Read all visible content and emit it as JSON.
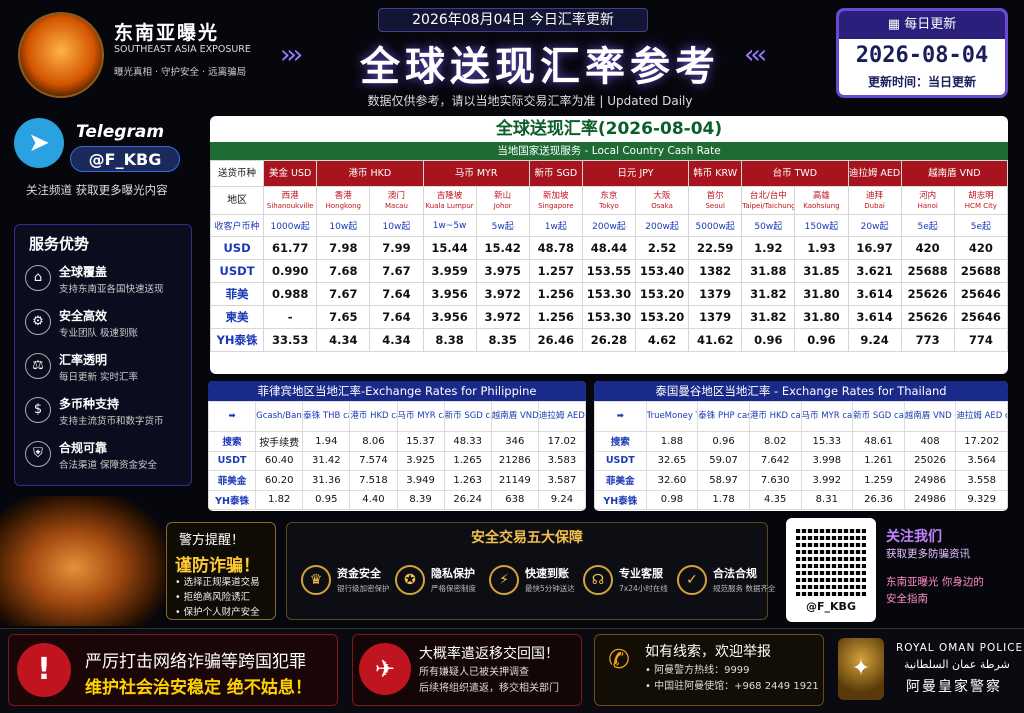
{
  "header": {
    "brand_cn": "东南亚曝光",
    "brand_en": "SOUTHEAST ASIA EXPOSURE",
    "brand_sub": "曝光真相 · 守护安全 · 远离骗局",
    "date_line": "2026年08月04日 今日汇率更新",
    "main_title": "全球送现汇率参考",
    "subtitle": "数据仅供参考，请以当地实际交易汇率为准 | Updated Daily",
    "daily_label": "每日更新",
    "daily_date": "2026-08-04",
    "daily_update": "更新时间：当日更新"
  },
  "telegram": {
    "title": "Telegram",
    "handle": "@F_KBG",
    "desc": "关注频道  获取更多曝光内容"
  },
  "advantages": {
    "title": "服务优势",
    "items": [
      {
        "icon": "building-icon",
        "title": "全球覆盖",
        "desc": "支持东南亚各国快速送现"
      },
      {
        "icon": "gear-icon",
        "title": "安全高效",
        "desc": "专业团队 极速到账"
      },
      {
        "icon": "balance-icon",
        "title": "汇率透明",
        "desc": "每日更新  实时汇率"
      },
      {
        "icon": "currency-icon",
        "title": "多币种支持",
        "desc": "支持主流货币和数字货币"
      },
      {
        "icon": "shield-icon",
        "title": "合规可靠",
        "desc": "合法渠道 保障资金安全"
      }
    ]
  },
  "main_table": {
    "title": "全球送现汇率(2026-08-04)",
    "subtitle": "当地国家送现服务 - Local Country Cash Rate",
    "row_labels": {
      "currency": "送货币种",
      "region": "地区",
      "receive": "收客户币种"
    },
    "currencies": [
      {
        "label": "美金 USD",
        "span": 1
      },
      {
        "label": "港币 HKD",
        "span": 2
      },
      {
        "label": "马币 MYR",
        "span": 2
      },
      {
        "label": "新币 SGD",
        "span": 1
      },
      {
        "label": "日元 JPY",
        "span": 2
      },
      {
        "label": "韩币 KRW",
        "span": 1
      },
      {
        "label": "台币 TWD",
        "span": 2
      },
      {
        "label": "迪拉姆 AED",
        "span": 1
      },
      {
        "label": "越南盾 VND",
        "span": 2
      }
    ],
    "regions": [
      {
        "cn": "西港",
        "en": "Sihanoukville"
      },
      {
        "cn": "香港",
        "en": "Hongkong"
      },
      {
        "cn": "澳门",
        "en": "Macau"
      },
      {
        "cn": "吉隆坡",
        "en": "Kuala Lumpur"
      },
      {
        "cn": "新山",
        "en": "Johor"
      },
      {
        "cn": "新加坡",
        "en": "Singapore"
      },
      {
        "cn": "东京",
        "en": "Tokyo"
      },
      {
        "cn": "大阪",
        "en": "Osaka"
      },
      {
        "cn": "首尔",
        "en": "Seoul"
      },
      {
        "cn": "台北/台中",
        "en": "Taipei/Taichung"
      },
      {
        "cn": "高雄",
        "en": "Kaohsiung"
      },
      {
        "cn": "迪拜",
        "en": "Dubai"
      },
      {
        "cn": "河内",
        "en": "Hanoi"
      },
      {
        "cn": "胡志明",
        "en": "HCM City"
      }
    ],
    "receive": [
      "1000w起",
      "10w起",
      "10w起",
      "1w~5w",
      "5w起",
      "1w起",
      "200w起",
      "200w起",
      "5000w起",
      "50w起",
      "150w起",
      "20w起",
      "5e起",
      "5e起"
    ],
    "rows": [
      {
        "label": "USD",
        "values": [
          "61.77",
          "7.98",
          "7.99",
          "15.44",
          "15.42",
          "48.78",
          "48.44",
          "2.52",
          "22.59",
          "1.92",
          "1.93",
          "16.97",
          "420",
          "420"
        ]
      },
      {
        "label": "USDT",
        "values": [
          "0.990",
          "7.68",
          "7.67",
          "3.959",
          "3.975",
          "1.257",
          "153.55",
          "153.40",
          "1382",
          "31.88",
          "31.85",
          "3.621",
          "25688",
          "25688"
        ]
      },
      {
        "label": "菲美",
        "values": [
          "0.988",
          "7.67",
          "7.64",
          "3.956",
          "3.972",
          "1.256",
          "153.30",
          "153.20",
          "1379",
          "31.82",
          "31.80",
          "3.614",
          "25626",
          "25646"
        ]
      },
      {
        "label": "柬美",
        "values": [
          "-",
          "7.65",
          "7.64",
          "3.956",
          "3.972",
          "1.256",
          "153.30",
          "153.20",
          "1379",
          "31.82",
          "31.80",
          "3.614",
          "25626",
          "25646"
        ]
      },
      {
        "label": "YH泰铢",
        "values": [
          "33.53",
          "4.34",
          "4.34",
          "8.38",
          "8.35",
          "26.46",
          "26.28",
          "4.62",
          "41.62",
          "0.96",
          "0.96",
          "9.24",
          "773",
          "774"
        ]
      }
    ]
  },
  "ph_table": {
    "title": "菲律宾地区当地汇率-Exchange Rates for Philippine",
    "headers": [
      "➡",
      "Gcash/Bank PHP",
      "泰铢 THB cash",
      "港币 HKD cash",
      "马币 MYR cash",
      "新币 SGD cash",
      "越南盾 VND cash",
      "迪拉姆 AED cash"
    ],
    "rows": [
      [
        "搜索",
        "按手续费",
        "1.94",
        "8.06",
        "15.37",
        "48.33",
        "346",
        "17.02"
      ],
      [
        "USDT",
        "60.40",
        "31.42",
        "7.574",
        "3.925",
        "1.265",
        "21286",
        "3.583"
      ],
      [
        "菲美金",
        "60.20",
        "31.36",
        "7.518",
        "3.949",
        "1.263",
        "21149",
        "3.587"
      ],
      [
        "YH泰铢",
        "1.82",
        "0.95",
        "4.40",
        "8.39",
        "26.24",
        "638",
        "9.24"
      ]
    ]
  },
  "th_table": {
    "title": "泰国曼谷地区当地汇率 - Exchange Rates for Thailand",
    "headers": [
      "➡",
      "TrueMoney THB",
      "泰铢 PHP cash",
      "港币 HKD cash",
      "马币 MYR cash",
      "新币 SGD cash",
      "越南盾 VND cash",
      "迪拉姆 AED cash"
    ],
    "rows": [
      [
        "搜索",
        "1.88",
        "0.96",
        "8.02",
        "15.33",
        "48.61",
        "408",
        "17.202"
      ],
      [
        "USDT",
        "32.65",
        "59.07",
        "7.642",
        "3.998",
        "1.261",
        "25026",
        "3.564"
      ],
      [
        "菲美金",
        "32.60",
        "58.97",
        "7.630",
        "3.992",
        "1.259",
        "24986",
        "3.558"
      ],
      [
        "YH泰铢",
        "0.98",
        "1.78",
        "4.35",
        "8.31",
        "26.36",
        "24986",
        "9.329"
      ]
    ]
  },
  "warning": {
    "title": "警方提醒！",
    "headline": "谨防诈骗！",
    "items": [
      "• 选择正规渠道交易",
      "• 拒绝高风险诱汇",
      "• 保护个人财产安全"
    ]
  },
  "guarantee": {
    "title": "安全交易五大保障",
    "items": [
      {
        "icon": "crown-shield-icon",
        "glyph": "♛",
        "title": "资金安全",
        "desc": "银行级加密保护"
      },
      {
        "icon": "user-lock-icon",
        "glyph": "✪",
        "title": "隐私保护",
        "desc": "严格保密制度"
      },
      {
        "icon": "lightning-icon",
        "glyph": "⚡",
        "title": "快速到账",
        "desc": "最快5分钟送达"
      },
      {
        "icon": "headset-icon",
        "glyph": "☊",
        "title": "专业客服",
        "desc": "7x24小时在线"
      },
      {
        "icon": "check-circle-icon",
        "glyph": "✓",
        "title": "合法合规",
        "desc": "规范服务 数据齐全"
      }
    ]
  },
  "qr": {
    "label": "@F_KBG"
  },
  "follow": {
    "title": "关注我们",
    "desc": "获取更多防骗资讯",
    "tagline1": "东南亚曝光 你身边的",
    "tagline2": "安全指南"
  },
  "bottom": {
    "crime_a": "严厉打击网络诈骗等跨国犯罪",
    "crime_b": "维护社会治安稳定  绝不姑息！",
    "repat_title": "大概率遣返移交回国！",
    "repat_1": "所有嫌疑人已被关押调查",
    "repat_2": "后续将组织遣返，移交相关部门",
    "report_title": "如有线索，欢迎举报",
    "report_1": "• 阿曼警方热线：9999",
    "report_2": "• 中国驻阿曼使馆：+968 2449 1921",
    "police_en": "ROYAL OMAN POLICE",
    "police_ar": "شرطة عمان السلطانية",
    "police_cn": "阿曼皇家警察"
  },
  "colors": {
    "accent": "#6a4ad0",
    "green": "#1e6b35",
    "red": "#a8141e",
    "blue": "#1a3ab5",
    "gold": "#f2c14e"
  }
}
